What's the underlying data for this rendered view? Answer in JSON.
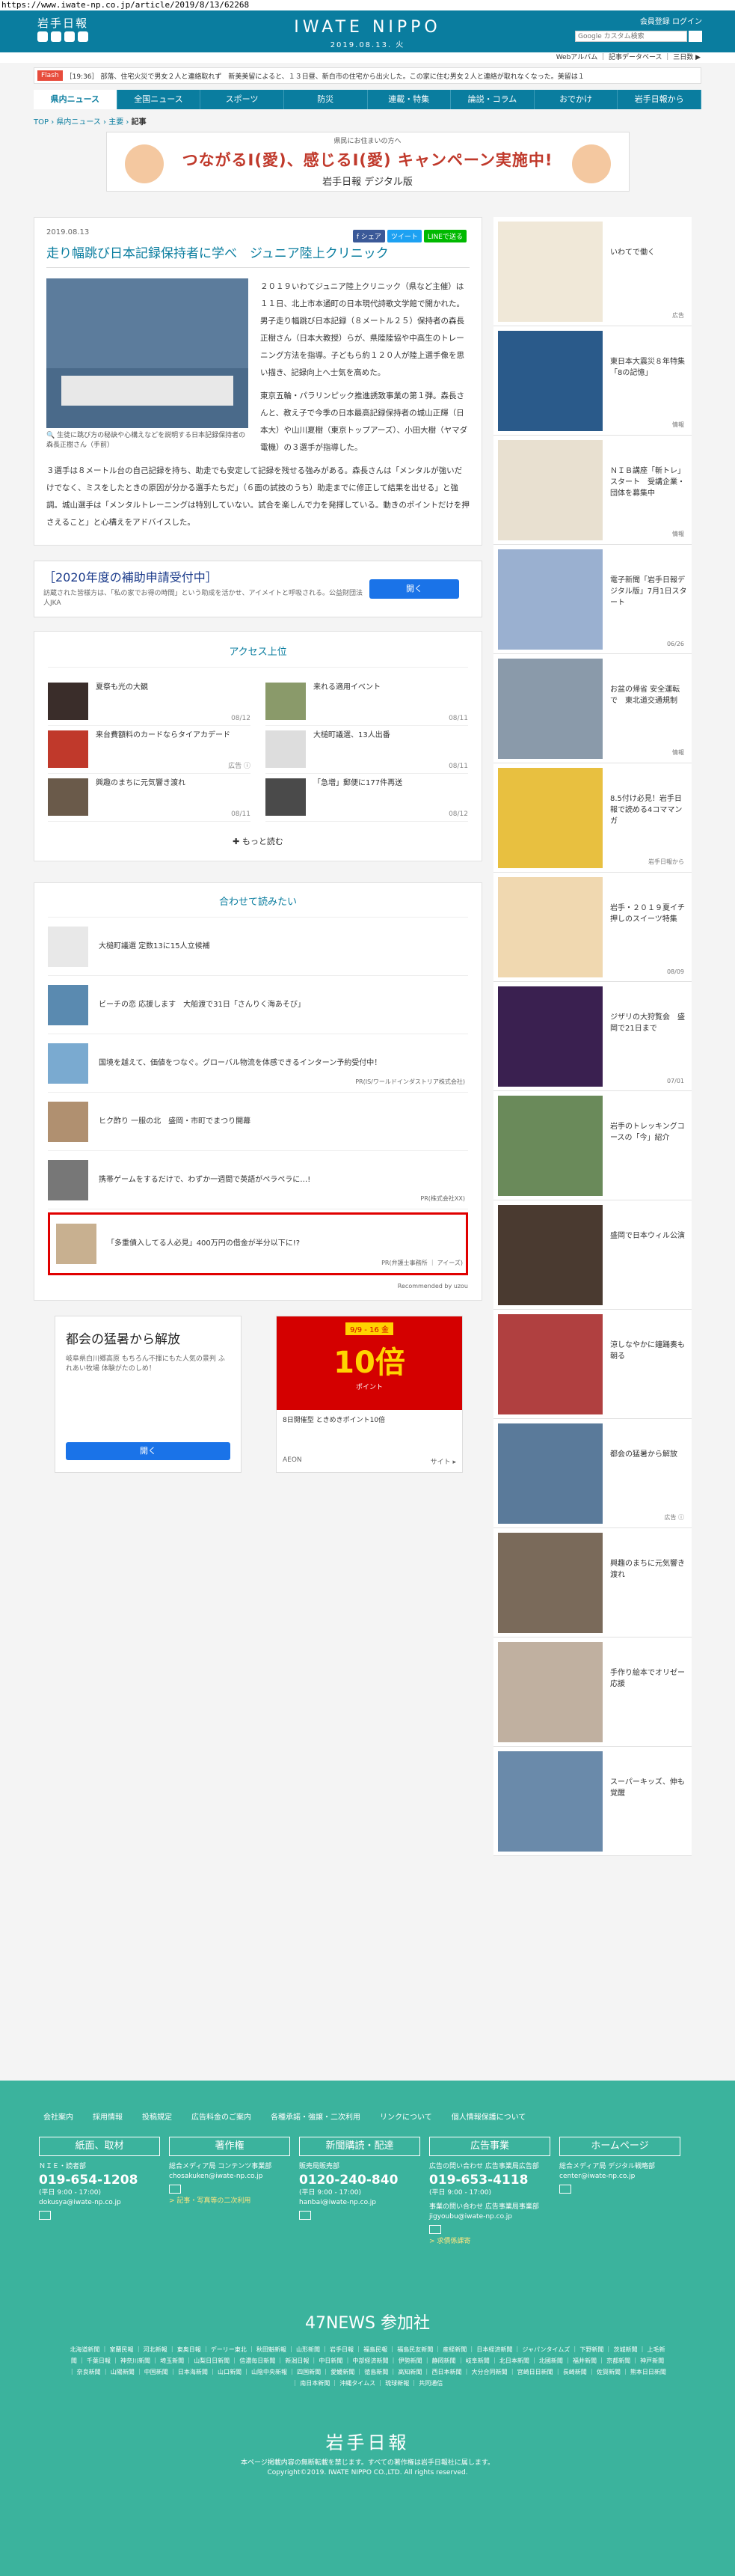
{
  "url": "https://www.iwate-np.co.jp/article/2019/8/13/62268",
  "header": {
    "logo": "岩手日報",
    "brand": "IWATE NIPPO",
    "date": "2019.08.13. 火",
    "login": "会員登録  ログイン",
    "search_placeholder": "Google カスタム検索",
    "subbar": "Webアルバム ｜ 記事データベース ｜ 三日数 ▶"
  },
  "ticker": {
    "tag": "Flash",
    "text": "［19:36］ 部落、住宅火災で男女２人と連絡取れず　新美美留によると、１３日昼、新白市の住宅から出火した。この家に住む男女２人と連絡が取れなくなった。美留は１"
  },
  "nav": [
    "県内ニュース",
    "全国ニュース",
    "スポーツ",
    "防災",
    "連載・特集",
    "論説・コラム",
    "おでかけ",
    "岩手日報から"
  ],
  "breadcrumb": {
    "top": "TOP",
    "sec": "県内ニュース",
    "sub": "主要",
    "cur": "記事"
  },
  "banner": {
    "small": "県民にお住まいの方へ",
    "big": "つながるI(愛)、感じるI(愛) キャンペーン実施中!",
    "sub": "岩手日報 デジタル版"
  },
  "article": {
    "date": "2019.08.13",
    "share": [
      "f シェア",
      "ツイート",
      "LINEで送る"
    ],
    "title": "走り幅跳び日本記録保持者に学べ　ジュニア陸上クリニック",
    "caption": "生徒に跳び方の秘訣や心構えなどを説明する日本記録保持者の森長正樹さん（手前）",
    "lead": "２０１９いわてジュニア陸上クリニック（県など主催）は１１日、北上市本通町の日本現代詩歌文学館で開かれた。男子走り幅跳び日本記録（８メートル２５）保持者の森長正樹さん（日本大教授）らが、県陸陸協や中高生のトレーニング方法を指導。子どもら約１２０人が陸上選手像を思い描き、記録向上へ士気を高めた。",
    "lead2": "東京五輪・パラリンピック推進誘致事業の第１弾。森長さんと、教え子で今季の日本最高記録保持者の城山正輝（日本大）や山川夏樹（東京トップアーズ）、小田大樹（ヤマダ電機）の３選手が指導した。",
    "rest": "３選手は８メートル台の自己記録を持ち、助走でも安定して記録を残せる強みがある。森長さんは「メンタルが強いだけでなく、ミスをしたときの原因が分かる選手たちだ」（６面の試技のうち）助走までに修正して結果を出せる」と強調。城山選手は「メンタルトレーニングは特別していない。試合を楽しんで力を発揮している。動きのポイントだけを押さえること」と心構えをアドバイスした。"
  },
  "ad1": {
    "title": "［2020年度の補助申請受付中］",
    "desc": "訪蔵された皆様方は、「私の家でお得の時間」という助成を活かせ、アイメイトと呼吸される。公益財団法人JKA",
    "btn": "開く"
  },
  "access": {
    "title": "アクセス上位",
    "items": [
      {
        "text": "夏祭も光の大観",
        "date": "08/12"
      },
      {
        "text": "来れる適用イベント",
        "date": "08/11"
      },
      {
        "text": "来台費額料のカードならタイアカデード",
        "date": "広告 ⓘ"
      },
      {
        "text": "大槌町議選、13人出番",
        "date": "08/11"
      },
      {
        "text": "興趣のまちに元気響き渡れ",
        "date": "08/11"
      },
      {
        "text": "「急増」郵便に177件再送",
        "date": "08/12"
      }
    ],
    "more": "✚ もっと読む"
  },
  "reco": {
    "title": "合わせて読みたい",
    "items": [
      {
        "text": "大槌町議選 定数13に15人立候補",
        "src": ""
      },
      {
        "text": "ビーチの恋 応援します　大船渡で31日「さんりく海あそび」",
        "src": ""
      },
      {
        "text": "国境を越えて、価値をつなぐ。グローバル物流を体感できるインターン予約受付中！",
        "src": "PR(IS/ワールドインダストリア株式会社)"
      },
      {
        "text": "ヒク酢り 一服の北　盛岡・市町でまつり開幕",
        "src": ""
      },
      {
        "text": "携帯ゲームをするだけで、わずか一週間で英語がペラペラに…!",
        "src": "PR(株式会社XX)"
      },
      {
        "text": "「多重債入してる人必見」400万円の借金が半分以下に!?",
        "src": "PR(弁護士事務所 ｜ アイーズ)"
      }
    ],
    "foot": "Recommended by uzou"
  },
  "ad2": {
    "title": "都会の猛暑から解放",
    "desc": "岐阜県白川郷高原 もちろん不揮にもた人気の景判 ふれあい牧場 体験がたのしめ！",
    "btn": "開く"
  },
  "ad3": {
    "a": "9/9 - 16 金",
    "b": "10倍",
    "c": "ポイント",
    "mid": "8日開催型 ときめきポイント10倍",
    "l": "AEON",
    "r": "サイト ▸"
  },
  "side": [
    {
      "text": "いわてで働く",
      "tag": "広告"
    },
    {
      "text": "東日本大震災８年特集「8の記憶」",
      "tag": "情報"
    },
    {
      "text": "ＮＩＢ講座「斬トレ」スタート　受講企業・団体を募集中",
      "tag": "情報"
    },
    {
      "text": "電子新聞「岩手日報デジタル版」7月1日スタート",
      "tag": "06/26"
    },
    {
      "text": "お盆の帰省 安全運転で　東北道交通規制",
      "tag": "情報"
    },
    {
      "text": "8.5付け必見！岩手日報で読める4コママンガ",
      "tag": "岩手日報から"
    },
    {
      "text": "岩手・２０１９夏イチ押しのスイーツ特集",
      "tag": "08/09"
    },
    {
      "text": "ジザリの大狩覧会　盛岡で21日まで",
      "tag": "07/01"
    },
    {
      "text": "岩手のトレッキングコースの「今」紹介",
      "tag": ""
    },
    {
      "text": "盛岡で日本ウィル公演",
      "tag": ""
    },
    {
      "text": "涼しなやかに鐘踊奏も朝る",
      "tag": ""
    },
    {
      "text": "都会の猛暑から解放",
      "tag": "広告 ⓘ"
    },
    {
      "text": "興趣のまちに元気響き渡れ",
      "tag": ""
    },
    {
      "text": "手作り絵本でオリゼー応援",
      "tag": ""
    },
    {
      "text": "スーパーキッズ、伸も覚醒",
      "tag": ""
    }
  ],
  "footer": {
    "links": [
      "会社案内",
      "採用情報",
      "投稿規定",
      "広告料金のご案内",
      "各種承諾・強譲・二次利用",
      "リンクについて",
      "個人情報保護について"
    ],
    "cols": [
      {
        "hd": "紙面、取材",
        "l1": "ＮＩＥ・読者部",
        "ph": "019-654-1208",
        "l2": "(平日 9:00 - 17:00)",
        "l3": "dokusya@iwate-np.co.jp",
        "y": ""
      },
      {
        "hd": "著作権",
        "l1": "総合メディア局 コンテンツ事業部",
        "ph": "",
        "l2": "chosakuken@iwate-np.co.jp",
        "l3": "",
        "y": "> 記事・写真等の二次利用"
      },
      {
        "hd": "新聞購読・配達",
        "l1": "販売局販売部",
        "ph": "0120-240-840",
        "l2": "(平日 9:00 - 17:00)",
        "l3": "hanbai@iwate-np.co.jp",
        "y": ""
      },
      {
        "hd": "広告事業",
        "l1": "広告の問い合わせ 広告事業局広告部",
        "ph": "019-653-4118",
        "l2": "(平日 9:00 - 17:00)",
        "l3": "事業の問い合わせ 広告事業局事業部 jigyoubu@iwate-np.co.jp",
        "y": "> 求債係課寄"
      },
      {
        "hd": "ホームページ",
        "l1": "総合メディア局 デジタル戦略部",
        "ph": "",
        "l2": "center@iwate-np.co.jp",
        "l3": "",
        "y": ""
      }
    ],
    "n47": "47NEWS 参加社",
    "n47list": "北海道新聞 ｜ 室蘭民報 ｜ 河北新報 ｜ 東奥日報 ｜ デーリー東北 ｜ 秋田魁新報 ｜ 山形新聞 ｜ 岩手日報 ｜ 福島民報 ｜ 福島民友新聞 ｜ 産経新聞 ｜ 日本経済新聞 ｜ ジャパンタイムズ ｜ 下野新聞 ｜ 茨城新聞 ｜ 上毛新聞 ｜ 千葉日報 ｜ 神奈川新聞 ｜ 埼玉新聞 ｜ 山梨日日新聞 ｜ 信濃毎日新聞 ｜ 新潟日報 ｜ 中日新聞 ｜ 中部経済新聞 ｜ 伊勢新聞 ｜ 静岡新聞 ｜ 岐阜新聞 ｜ 北日本新聞 ｜ 北國新聞 ｜ 福井新聞 ｜ 京都新聞 ｜ 神戸新聞 ｜ 奈良新聞 ｜ 山陽新聞 ｜ 中国新聞 ｜ 日本海新聞 ｜ 山口新聞 ｜ 山陰中央新報 ｜ 四国新聞 ｜ 愛媛新聞 ｜ 徳島新聞 ｜ 高知新聞 ｜ 西日本新聞 ｜ 大分合同新聞 ｜ 宮崎日日新聞 ｜ 長崎新聞 ｜ 佐賀新聞 ｜ 熊本日日新聞 ｜ 南日本新聞 ｜ 沖縄タイムス ｜ 琉球新報 ｜ 共同通信",
    "logo": "岩手日報",
    "copy1": "本ページ掲載内容の無断転載を禁じます。すべての著作権は岩手日報社に属します。",
    "copy2": "Copyright©2019. IWATE NIPPO CO.,LTD. All rights reserved."
  }
}
